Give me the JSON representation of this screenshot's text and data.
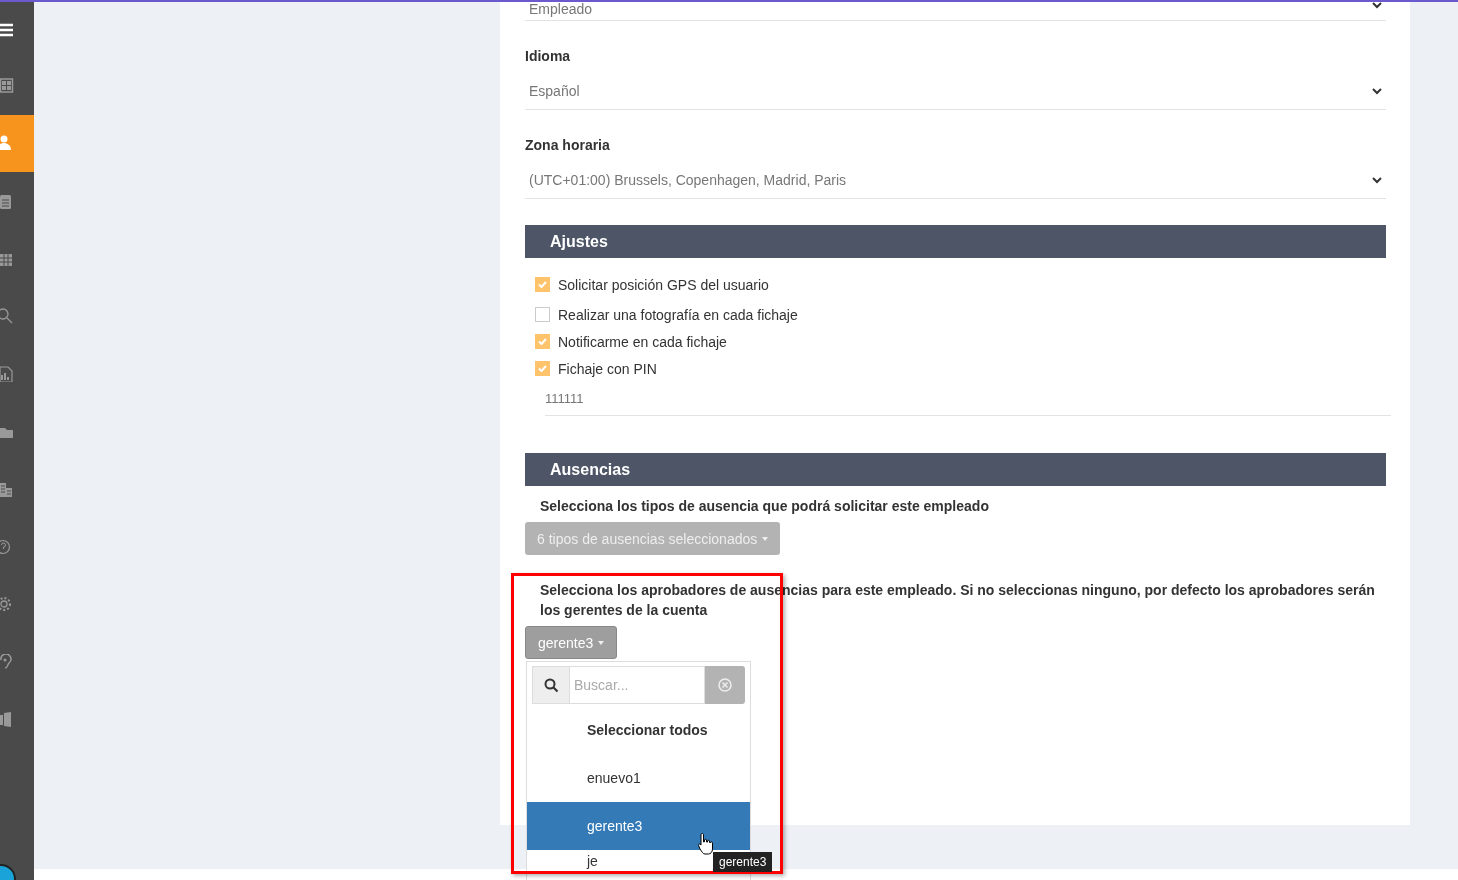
{
  "sidebar": {
    "items": [
      {
        "selected": false
      },
      {
        "selected": false
      },
      {
        "selected": true
      },
      {
        "selected": false
      },
      {
        "selected": false
      },
      {
        "selected": false
      },
      {
        "selected": false
      },
      {
        "selected": false
      },
      {
        "selected": false
      },
      {
        "selected": false
      },
      {
        "selected": false
      },
      {
        "selected": false
      },
      {
        "selected": false
      }
    ]
  },
  "fields": [
    {
      "value": "Empleado"
    },
    {
      "label": "Idioma",
      "value": "Español"
    },
    {
      "label": "Zona horaria",
      "value": "(UTC+01:00) Brussels, Copenhagen, Madrid, Paris"
    }
  ],
  "ajustes": {
    "title": "Ajustes",
    "options": [
      {
        "label": "Solicitar posición GPS del usuario",
        "checked": true
      },
      {
        "label": "Realizar una fotografía en cada fichaje",
        "checked": false
      },
      {
        "label": "Notificarme en cada fichaje",
        "checked": true
      },
      {
        "label": "Fichaje con PIN",
        "checked": true
      }
    ],
    "pin": "111111"
  },
  "ausencias": {
    "title": "Ausencias",
    "types_prompt": "Selecciona los tipos de ausencia que podrá solicitar este empleado",
    "types_button": "6 tipos de ausencias seleccionados",
    "approvers_prompt": "Selecciona los aprobadores de ausencias para este empleado. Si no seleccionas ninguno, por defecto los aprobadores serán los gerentes de la cuenta",
    "approvers_button": "gerente3",
    "menu": {
      "search_placeholder": "Buscar...",
      "select_all": "Seleccionar todos",
      "options": [
        {
          "label": "enuevo1",
          "selected": false
        },
        {
          "label": "gerente3",
          "selected": true
        },
        {
          "label": "je",
          "selected": false
        }
      ]
    },
    "tooltip": "gerente3"
  }
}
